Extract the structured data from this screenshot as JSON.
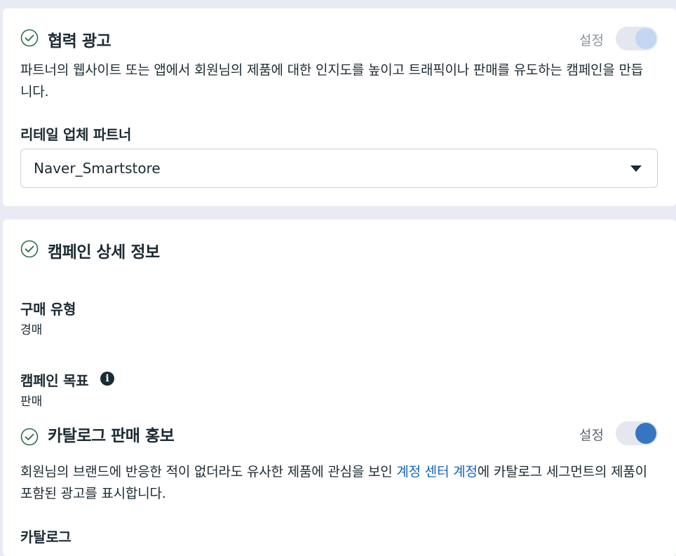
{
  "sections": {
    "partnership_ads": {
      "title": "협력 광고",
      "toggle_label": "설정",
      "toggle_state": "off",
      "description": "파트너의 웹사이트 또는 앱에서 회원님의 제품에 대한 인지도를 높이고 트래픽이나 판매를 유도하는 캠페인을 만듭니다.",
      "retail_partner_label": "리테일 업체 파트너",
      "retail_partner_value": "Naver_Smartstore"
    },
    "campaign_details": {
      "title": "캠페인 상세 정보",
      "purchase_type_label": "구매 유형",
      "purchase_type_value": "경매",
      "objective_label": "캠페인 목표",
      "objective_value": "판매"
    },
    "catalog_promotion": {
      "title": "카탈로그 판매 홍보",
      "toggle_label": "설정",
      "toggle_state": "on",
      "description_before": "회원님의 브랜드에 반응한 적이 없더라도 유사한 제품에 관심을 보인 ",
      "description_link": "계정 센터 계정",
      "description_after": "에 카탈로그 세그먼트의 제품이 포함된 광고를 표시합니다.",
      "catalog_label": "카탈로그"
    }
  },
  "icons": {
    "check": "check-circle-icon",
    "info": "info-icon",
    "caret": "caret-down-icon"
  },
  "colors": {
    "accent_blue": "#3675c2",
    "link_blue": "#1466b8",
    "check_green": "#2f6b4a",
    "text_dark": "#1c2b33"
  }
}
